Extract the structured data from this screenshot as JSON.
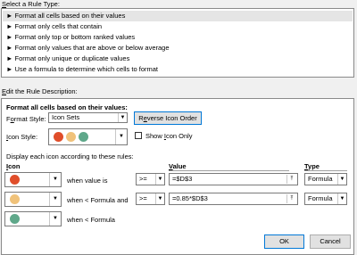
{
  "header": {
    "select_rule_type": "Select a Rule Type:"
  },
  "rule_types": [
    "► Format all cells based on their values",
    "► Format only cells that contain",
    "► Format only top or bottom ranked values",
    "► Format only values that are above or below average",
    "► Format only unique or duplicate values",
    "► Use a formula to determine which cells to format"
  ],
  "description": {
    "edit_label": "Edit the Rule Description:",
    "section_title": "Format all cells based on their values:",
    "format_style_label": "Format Style:",
    "format_style_value": "Icon Sets",
    "reverse_button": "Reverse Icon Order",
    "icon_style_label": "Icon Style:",
    "show_icon_only": "Show Icon Only",
    "display_rules_text": "Display each icon according to these rules:",
    "col_icon": "Icon",
    "col_value": "Value",
    "col_type": "Type"
  },
  "icon_rules": [
    {
      "condition": "when value is",
      "operator": ">=",
      "value": "=$D$3",
      "type": "Formula",
      "color": "#e04e2a"
    },
    {
      "condition": "when < Formula and",
      "operator": ">=",
      "value": "=0.85*$D$3",
      "type": "Formula",
      "color": "#f0c27a"
    },
    {
      "condition": "when < Formula",
      "color": "#5fa88a"
    }
  ],
  "icon_style_colors": [
    "#e04e2a",
    "#f0c27a",
    "#5fa88a"
  ],
  "footer": {
    "ok": "OK",
    "cancel": "Cancel"
  }
}
